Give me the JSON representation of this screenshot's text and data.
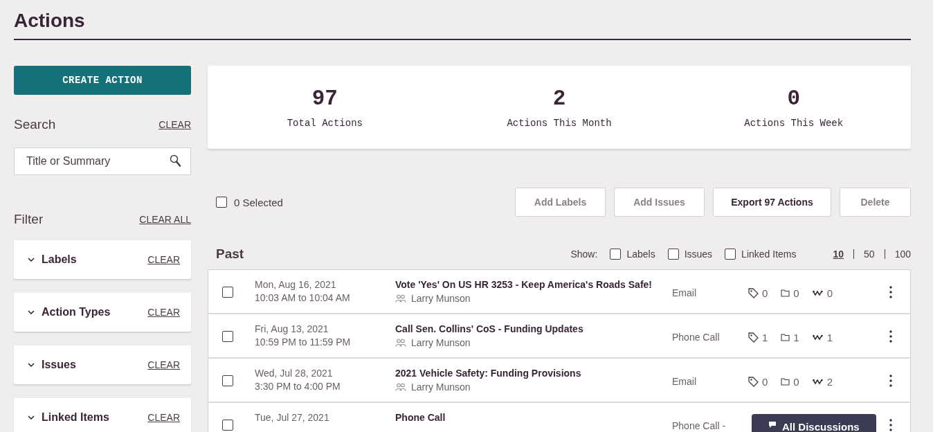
{
  "page_title": "Actions",
  "create_button": "CREATE ACTION",
  "search": {
    "heading": "Search",
    "clear": "CLEAR",
    "placeholder": "Title or Summary"
  },
  "filter": {
    "heading": "Filter",
    "clear_all": "CLEAR ALL",
    "sections": [
      {
        "label": "Labels",
        "clear": "CLEAR",
        "expanded": false
      },
      {
        "label": "Action Types",
        "clear": "CLEAR",
        "expanded": false
      },
      {
        "label": "Issues",
        "clear": "CLEAR",
        "expanded": false
      },
      {
        "label": "Linked Items",
        "clear": "CLEAR",
        "expanded": false
      }
    ]
  },
  "stats": [
    {
      "value": "97",
      "label": "Total Actions"
    },
    {
      "value": "2",
      "label": "Actions This Month"
    },
    {
      "value": "0",
      "label": "Actions This Week"
    }
  ],
  "select_all": {
    "label": "0 Selected",
    "checked": false
  },
  "bulk_buttons": [
    {
      "label": "Add Labels",
      "disabled": true
    },
    {
      "label": "Add Issues",
      "disabled": true
    },
    {
      "label": "Export 97 Actions",
      "disabled": false
    },
    {
      "label": "Delete",
      "disabled": true
    }
  ],
  "section_title": "Past",
  "show": {
    "label": "Show:",
    "options": [
      {
        "label": "Labels",
        "checked": false
      },
      {
        "label": "Issues",
        "checked": false
      },
      {
        "label": "Linked Items",
        "checked": false
      }
    ]
  },
  "page_sizes": [
    {
      "label": "10",
      "selected": true
    },
    {
      "label": "50",
      "selected": false
    },
    {
      "label": "100",
      "selected": false
    }
  ],
  "rows": [
    {
      "checked": false,
      "date": "Mon, Aug 16, 2021",
      "time": "10:03 AM to 10:04 AM",
      "title": "Vote 'Yes' On US HR 3253 - Keep America's Roads Safe!",
      "person": "Larry Munson",
      "type": "Email",
      "labels": "0",
      "issues": "0",
      "links": "0"
    },
    {
      "checked": false,
      "date": "Fri, Aug 13, 2021",
      "time": "10:59 PM to 11:59 PM",
      "title": "Call Sen. Collins' CoS - Funding Updates",
      "person": "Larry Munson",
      "type": "Phone Call",
      "labels": "1",
      "issues": "1",
      "links": "1"
    },
    {
      "checked": false,
      "date": "Wed, Jul 28, 2021",
      "time": "3:30 PM to 4:00 PM",
      "title": "2021 Vehicle Safety: Funding Provisions",
      "person": "Larry Munson",
      "type": "Email",
      "labels": "0",
      "issues": "0",
      "links": "2"
    },
    {
      "checked": false,
      "date": "Tue, Jul 27, 2021",
      "title": "Phone Call",
      "type": "Phone Call -"
    }
  ],
  "discussions_button": "All Discussions"
}
